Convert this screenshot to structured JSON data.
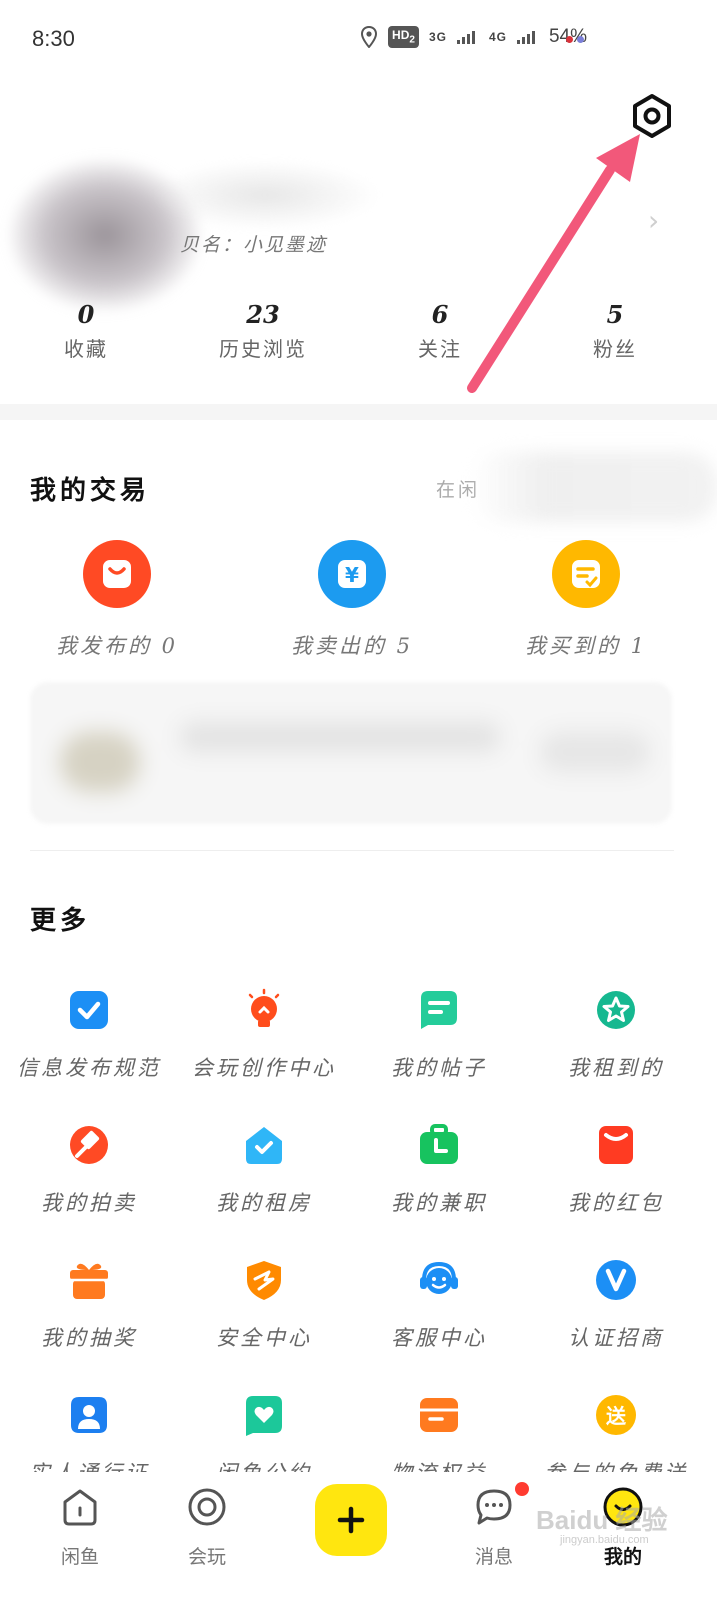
{
  "status_bar": {
    "time": "8:30",
    "hd": "HD",
    "hd_sub": "2",
    "net1": "3G",
    "net2": "4G",
    "battery": "54%",
    "dot_colors": [
      "#d9323a",
      "#7b7fd8"
    ]
  },
  "profile": {
    "subtitle": "贝名：小见墨迹",
    "settings_icon": "gear-icon",
    "stats": [
      {
        "num": "0",
        "label": "收藏"
      },
      {
        "num": "23",
        "label": "历史浏览"
      },
      {
        "num": "6",
        "label": "关注"
      },
      {
        "num": "5",
        "label": "粉丝"
      }
    ]
  },
  "trade": {
    "title": "我的交易",
    "side_text": "在闲",
    "items": [
      {
        "label": "我发布的 0",
        "color": "#ff4a24",
        "icon": "bag-icon"
      },
      {
        "label": "我卖出的 5",
        "color": "#1c9bf0",
        "icon": "yen-icon"
      },
      {
        "label": "我买到的 1",
        "color": "#ffb800",
        "icon": "receipt-icon"
      }
    ]
  },
  "more": {
    "title": "更多",
    "items": [
      {
        "label": "信息发布规范",
        "icon": "check-doc-icon",
        "color": "#1c8ff5"
      },
      {
        "label": "会玩创作中心",
        "icon": "bulb-icon",
        "color": "#ff4d1c"
      },
      {
        "label": "我的帖子",
        "icon": "post-icon",
        "color": "#24cc9a"
      },
      {
        "label": "我租到的",
        "icon": "star-badge-icon",
        "color": "#16b890"
      },
      {
        "label": "我的拍卖",
        "icon": "gavel-icon",
        "color": "#ff4a24"
      },
      {
        "label": "我的租房",
        "icon": "house-icon",
        "color": "#2fb6f7"
      },
      {
        "label": "我的兼职",
        "icon": "briefcase-icon",
        "color": "#17c35f"
      },
      {
        "label": "我的红包",
        "icon": "red-packet-icon",
        "color": "#ff3b22"
      },
      {
        "label": "我的抽奖",
        "icon": "gift-icon",
        "color": "#ff7a1f"
      },
      {
        "label": "安全中心",
        "icon": "shield-icon",
        "color": "#ff8a00"
      },
      {
        "label": "客服中心",
        "icon": "headset-icon",
        "color": "#1c8ff5"
      },
      {
        "label": "认证招商",
        "icon": "verify-icon",
        "color": "#1c8ff5"
      },
      {
        "label": "实人通行证",
        "icon": "person-icon",
        "color": "#1c7ff0"
      },
      {
        "label": "闲鱼公约",
        "icon": "heart-doc-icon",
        "color": "#1cc89a"
      },
      {
        "label": "物流权益",
        "icon": "box-icon",
        "color": "#ff7a1f"
      },
      {
        "label": "参与的免费送",
        "icon": "send-icon",
        "color": "#ffb800",
        "glyph": "送"
      }
    ]
  },
  "tabbar": {
    "tabs": [
      {
        "label": "闲鱼",
        "icon": "home-icon"
      },
      {
        "label": "会玩",
        "icon": "ring-icon"
      },
      {
        "label": "消息",
        "icon": "message-icon"
      },
      {
        "label": "我的",
        "icon": "face-icon"
      }
    ],
    "publish_icon": "plus-icon"
  },
  "watermark": {
    "text": "Baidu 经验",
    "sub": "jingyan.baidu.com"
  }
}
